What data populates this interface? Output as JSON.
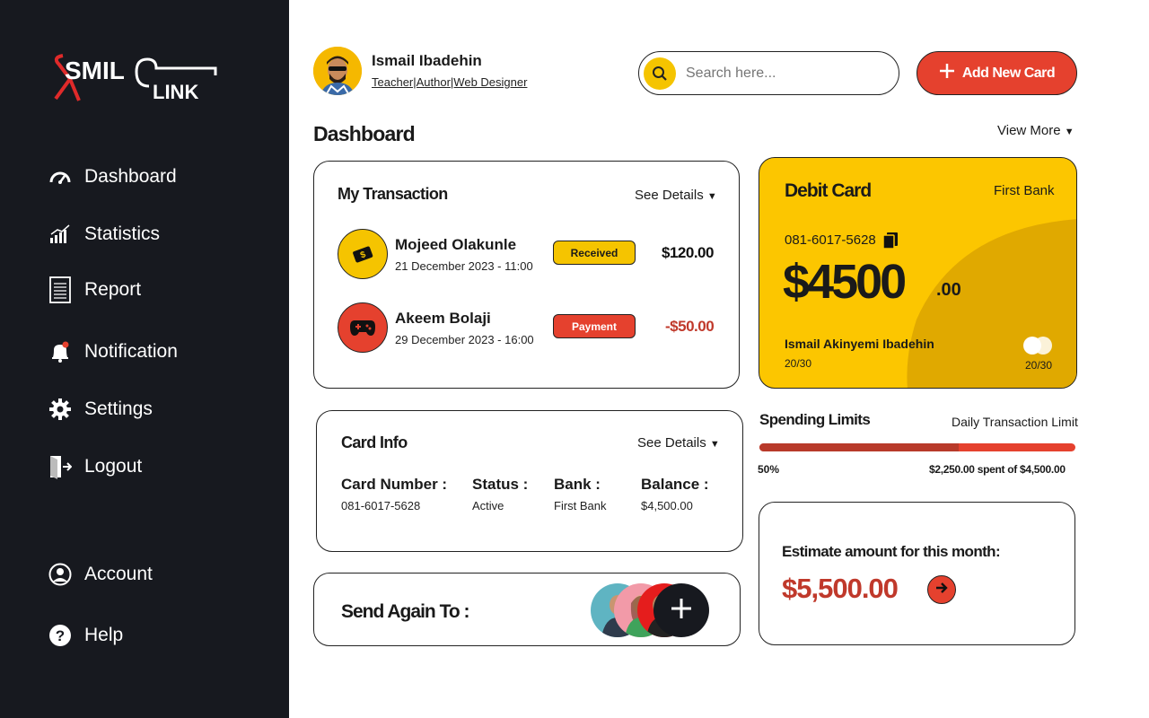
{
  "brand": {
    "logo_text": "SMILELINK"
  },
  "sidebar": {
    "items": [
      {
        "label": "Dashboard",
        "icon": "gauge-icon"
      },
      {
        "label": "Statistics",
        "icon": "bar-chart-icon"
      },
      {
        "label": "Report",
        "icon": "document-icon"
      },
      {
        "label": "Notification",
        "icon": "bell-icon"
      },
      {
        "label": "Settings",
        "icon": "gear-icon"
      },
      {
        "label": "Logout",
        "icon": "logout-icon"
      }
    ],
    "bottom_items": [
      {
        "label": "Account",
        "icon": "user-circle-icon"
      },
      {
        "label": "Help",
        "icon": "help-icon"
      }
    ]
  },
  "header": {
    "user_name": "Ismail Ibadehin",
    "user_role": "Teacher|Author|Web Designer",
    "search_placeholder": "Search here...",
    "add_card_label": "Add New Card"
  },
  "page": {
    "title": "Dashboard",
    "view_more": "View More"
  },
  "transactions": {
    "title": "My Transaction",
    "see_details": "See Details",
    "items": [
      {
        "name": "Mojeed Olakunle",
        "date": "21 December 2023 - 11:00",
        "status": "Received",
        "amount": "$120.00",
        "color": "#f5c400",
        "icon": "money-icon"
      },
      {
        "name": "Akeem Bolaji",
        "date": "29 December 2023 - 16:00",
        "status": "Payment",
        "amount": "-$50.00",
        "color": "#e5412e",
        "icon": "gamepad-icon"
      }
    ]
  },
  "card_info": {
    "title": "Card Info",
    "see_details": "See Details",
    "fields": [
      {
        "label": "Card Number :",
        "value": "081-6017-5628"
      },
      {
        "label": "Status :",
        "value": "Active"
      },
      {
        "label": "Bank :",
        "value": "First Bank"
      },
      {
        "label": "Balance :",
        "value": "$4,500.00"
      }
    ]
  },
  "send_again": {
    "title": "Send Again To :"
  },
  "debit_card": {
    "title": "Debit Card",
    "bank": "First Bank",
    "number": "081-6017-5628",
    "balance_main": "$4500",
    "balance_cents": ".00",
    "holder": "Ismail Akinyemi Ibadehin",
    "expiry_left": "20/30",
    "expiry_right": "20/30",
    "color": "#fcc600"
  },
  "spending": {
    "title": "Spending Limits",
    "subtitle": "Daily Transaction Limit",
    "percent_label": "50%",
    "spent_label": "$2,250.00 spent of $4,500.00",
    "fraction": 0.63
  },
  "estimate": {
    "title": "Estimate amount for this month:",
    "amount": "$5,500.00"
  },
  "colors": {
    "accent_red": "#e5412e",
    "accent_yellow": "#f5c400",
    "sidebar_bg": "#17191f"
  }
}
